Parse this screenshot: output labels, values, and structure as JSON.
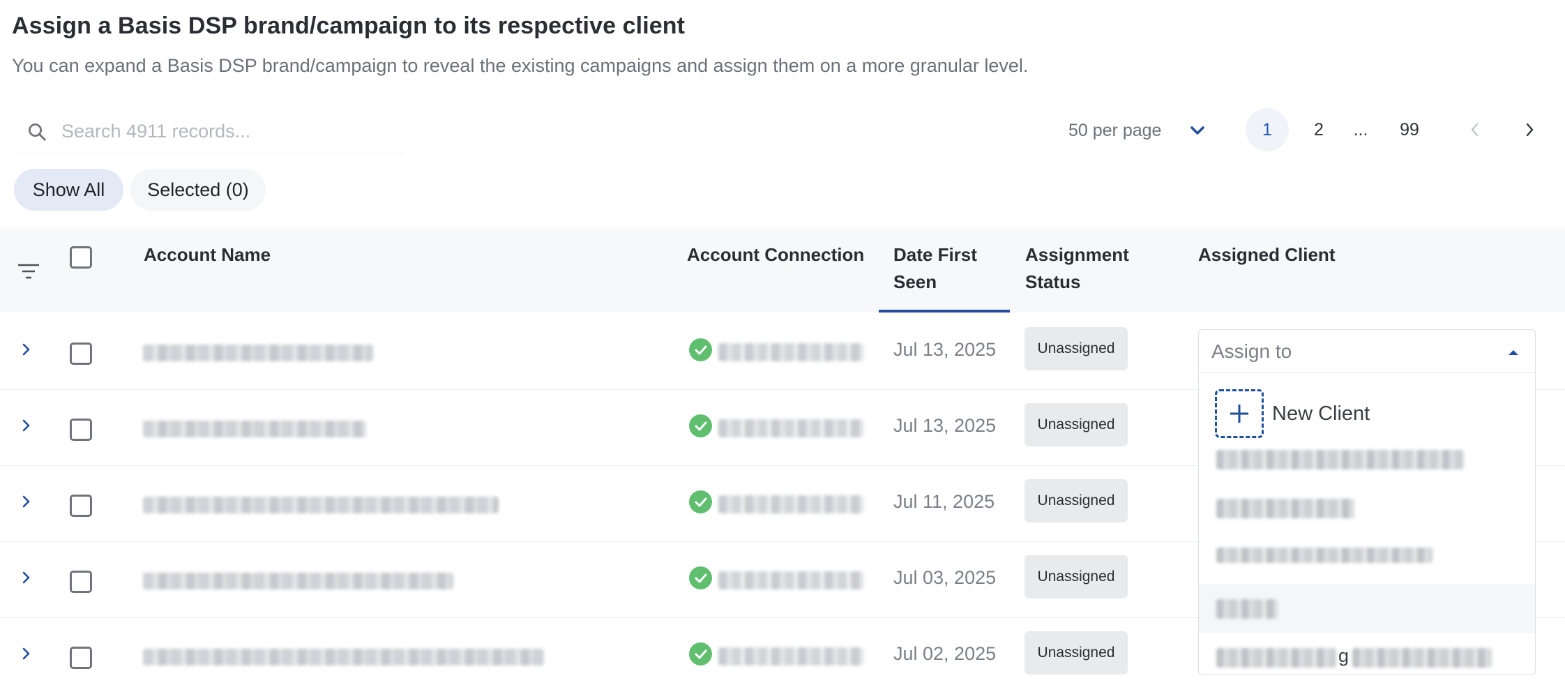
{
  "header": {
    "title": "Assign a Basis DSP brand/campaign to its respective client",
    "subtitle": "You can expand a Basis DSP brand/campaign to reveal the existing campaigns and assign them on a more granular level."
  },
  "search": {
    "placeholder": "Search 4911 records..."
  },
  "pagination": {
    "per_page": "50 per page",
    "pages": [
      "1",
      "2",
      "...",
      "99"
    ],
    "current": "1"
  },
  "filters": {
    "show_all": "Show All",
    "selected": "Selected (0)"
  },
  "table": {
    "columns": {
      "account_name": "Account Name",
      "account_connection": "Account Connection",
      "date_first_seen": "Date First Seen",
      "assignment_status": "Assignment Status",
      "assigned_client": "Assigned Client"
    },
    "rows": [
      {
        "date": "Jul 13, 2025",
        "status": "Unassigned"
      },
      {
        "date": "Jul 13, 2025",
        "status": "Unassigned"
      },
      {
        "date": "Jul 11, 2025",
        "status": "Unassigned"
      },
      {
        "date": "Jul 03, 2025",
        "status": "Unassigned"
      },
      {
        "date": "Jul 02, 2025",
        "status": "Unassigned"
      }
    ]
  },
  "assign_dropdown": {
    "placeholder": "Assign to",
    "new_client_label": "New Client",
    "partial_visible_text": "g"
  },
  "colors": {
    "accent": "#1f4e9c",
    "success": "#5fbf6e",
    "active_pill": "#e3eaf6"
  },
  "icons": [
    "search-icon",
    "chevron-down-icon",
    "chevron-left-icon",
    "chevron-right-icon",
    "filter-icon",
    "check-circle-icon",
    "plus-icon",
    "caret-up-icon"
  ]
}
